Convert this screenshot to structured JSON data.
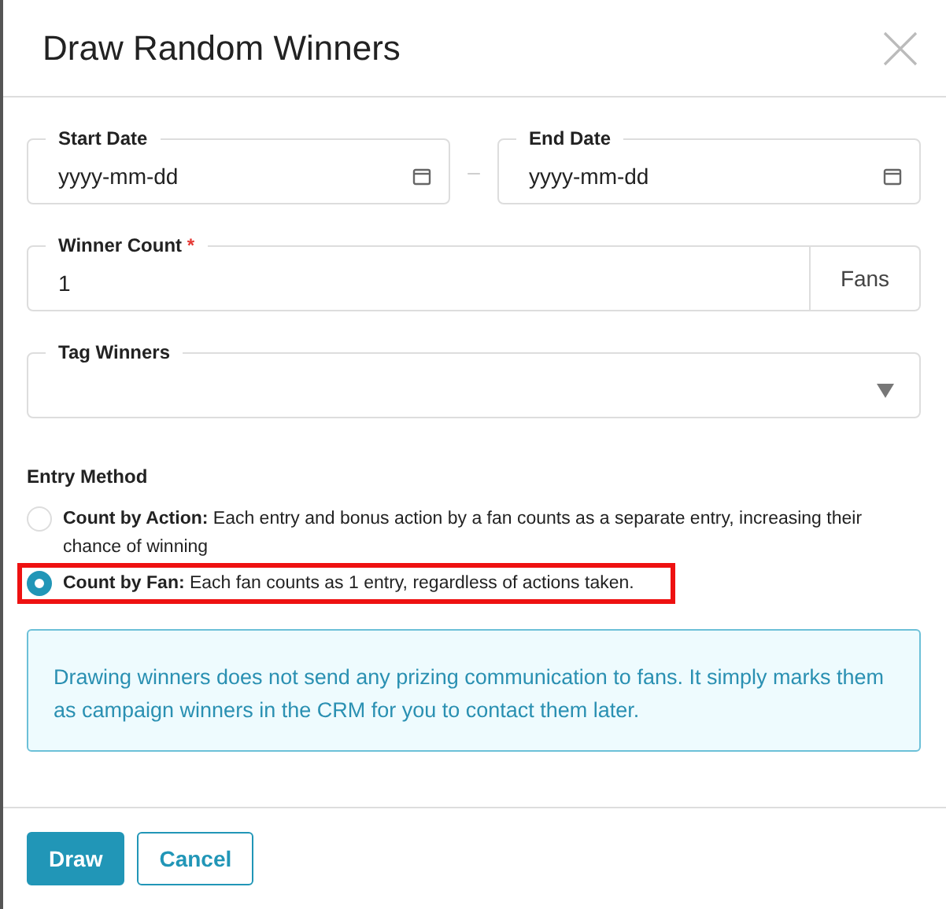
{
  "dialog": {
    "title": "Draw Random Winners"
  },
  "date_range": {
    "start": {
      "label": "Start Date",
      "placeholder": "yyyy-mm-dd"
    },
    "separator": "–",
    "end": {
      "label": "End Date",
      "placeholder": "yyyy-mm-dd"
    }
  },
  "winner_count": {
    "label": "Winner Count",
    "required_mark": "*",
    "value": "1",
    "unit": "Fans"
  },
  "tag_winners": {
    "label": "Tag Winners"
  },
  "entry_method": {
    "label": "Entry Method",
    "options": [
      {
        "text": "**Count by Action:** Each entry and bonus action by a fan counts as a separate entry, increasing their chance of winning",
        "selected": false,
        "highlighted": false
      },
      {
        "text": "**Count by Fan:** Each fan counts as 1 entry, regardless of actions taken.",
        "selected": true,
        "highlighted": true
      }
    ]
  },
  "notice": "Drawing winners does not send any prizing communication to fans. It simply marks them as campaign winners in the CRM for you to contact them later.",
  "buttons": [
    {
      "label": "Draw",
      "kind": "primary"
    },
    {
      "label": "Cancel",
      "kind": "secondary"
    }
  ]
}
